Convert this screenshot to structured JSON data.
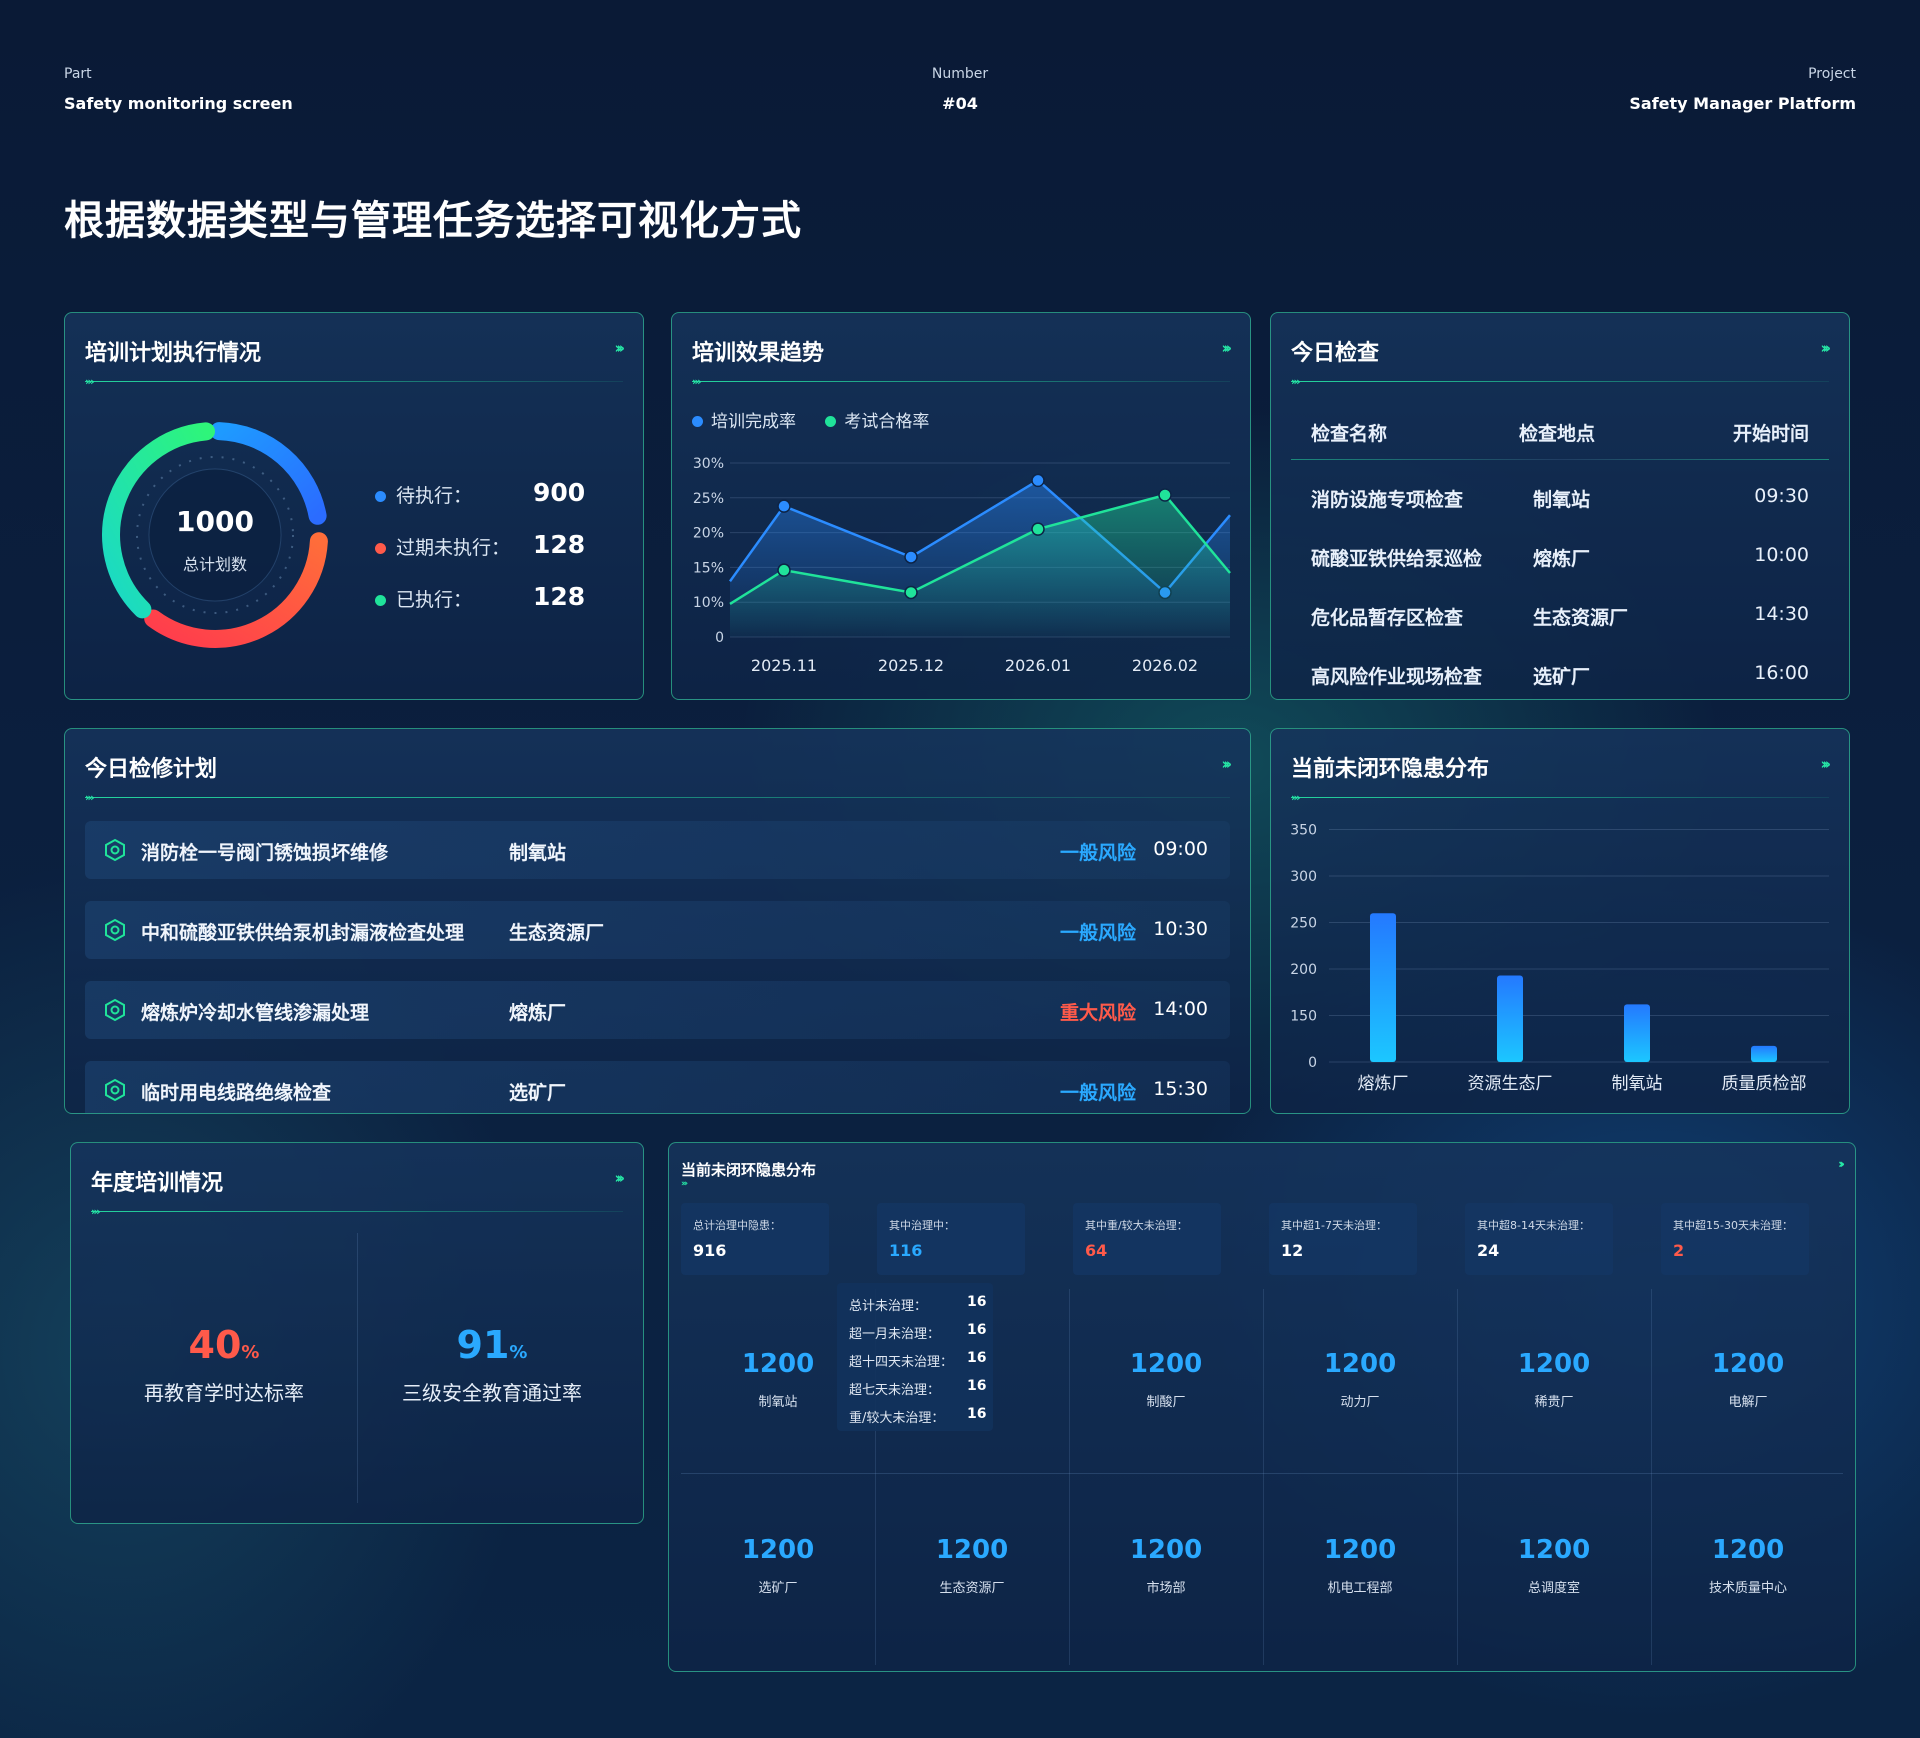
{
  "header": {
    "part_label": "Part",
    "part_value": "Safety monitoring screen",
    "number_label": "Number",
    "number_value": "#04",
    "project_label": "Project",
    "project_value": "Safety Manager Platform",
    "title": "根据数据类型与管理任务选择可视化方式"
  },
  "training_plan": {
    "title": "培训计划执行情况",
    "total": "1000",
    "total_label": "总计划数",
    "legend": [
      {
        "label": "待执行：",
        "value": "900",
        "color": "#2b8cff"
      },
      {
        "label": "过期未执行：",
        "value": "128",
        "color": "#ff5a4a"
      },
      {
        "label": "已执行：",
        "value": "128",
        "color": "#20e39a"
      }
    ]
  },
  "training_effect": {
    "title": "培训效果趋势",
    "chart_data": {
      "type": "area",
      "x": [
        "2025.11",
        "2025.12",
        "2026.01",
        "2026.02"
      ],
      "y_ticks": [
        "0",
        "10%",
        "15%",
        "20%",
        "25%",
        "30%"
      ],
      "series": [
        {
          "name": "培训完成率",
          "color": "#2b8cff",
          "values": [
            23.8,
            16.5,
            27.5,
            11.4
          ]
        },
        {
          "name": "考试合格率",
          "color": "#20e39a",
          "values": [
            14.6,
            11.4,
            20.5,
            25.4
          ]
        }
      ],
      "left_edge": {
        "培训完成率": 13,
        "考试合格率": 9.5
      },
      "right_edge": {
        "培训完成率": 22.5,
        "考试合格率": 14.2
      }
    }
  },
  "today_check": {
    "title": "今日检查",
    "headers": [
      "检查名称",
      "检查地点",
      "开始时间"
    ],
    "rows": [
      [
        "消防设施专项检查",
        "制氧站",
        "09:30"
      ],
      [
        "硫酸亚铁供给泵巡检",
        "熔炼厂",
        "10:00"
      ],
      [
        "危化品暂存区检查",
        "生态资源厂",
        "14:30"
      ],
      [
        "高风险作业现场检查",
        "选矿厂",
        "16:00"
      ]
    ]
  },
  "maintenance": {
    "title": "今日检修计划",
    "rows": [
      {
        "name": "消防栓一号阀门锈蚀损坏维修",
        "loc": "制氧站",
        "risk": "一般风险",
        "risk_color": "#2aa9ff",
        "time": "09:00"
      },
      {
        "name": "中和硫酸亚铁供给泵机封漏液检查处理",
        "loc": "生态资源厂",
        "risk": "一般风险",
        "risk_color": "#2aa9ff",
        "time": "10:30"
      },
      {
        "name": "熔炼炉冷却水管线渗漏处理",
        "loc": "熔炼厂",
        "risk": "重大风险",
        "risk_color": "#ff5a4a",
        "time": "14:00"
      },
      {
        "name": "临时用电线路绝缘检查",
        "loc": "选矿厂",
        "risk": "一般风险",
        "risk_color": "#2aa9ff",
        "time": "15:30"
      }
    ]
  },
  "hazard_bar": {
    "title": "当前未闭环隐患分布",
    "chart_data": {
      "type": "bar",
      "categories": [
        "熔炼厂",
        "资源生态厂",
        "制氧站",
        "质量质检部"
      ],
      "values": [
        260,
        193,
        162,
        52
      ],
      "ylim": [
        0,
        350
      ],
      "y_ticks": [
        "0",
        "150",
        "200",
        "250",
        "300",
        "350"
      ]
    }
  },
  "annual_training": {
    "title": "年度培训情况",
    "items": [
      {
        "value": "40",
        "unit": "%",
        "label": "再教育学时达标率",
        "color": "#ff5a4a"
      },
      {
        "value": "91",
        "unit": "%",
        "label": "三级安全教育通过率",
        "color": "#2aa9ff"
      }
    ]
  },
  "hazard_summary": {
    "title": "当前未闭环隐患分布",
    "cards": [
      {
        "label": "总计治理中隐患：",
        "value": "916",
        "color": "#ffffff"
      },
      {
        "label": "其中治理中：",
        "value": "116",
        "color": "#2aa9ff"
      },
      {
        "label": "其中重/较大未治理：",
        "value": "64",
        "color": "#ff5a4a"
      },
      {
        "label": "其中超1-7天未治理：",
        "value": "12",
        "color": "#ffffff"
      },
      {
        "label": "其中超8-14天未治理：",
        "value": "24",
        "color": "#ffffff"
      },
      {
        "label": "其中超15-30天未治理：",
        "value": "2",
        "color": "#ff5a4a"
      }
    ],
    "row1": [
      {
        "value": "1200",
        "label": "制氧站"
      },
      {
        "value": "",
        "label": ""
      },
      {
        "value": "1200",
        "label": "制酸厂"
      },
      {
        "value": "1200",
        "label": "动力厂"
      },
      {
        "value": "1200",
        "label": "稀贵厂"
      },
      {
        "value": "1200",
        "label": "电解厂"
      }
    ],
    "row2": [
      {
        "value": "1200",
        "label": "选矿厂"
      },
      {
        "value": "1200",
        "label": "生态资源厂"
      },
      {
        "value": "1200",
        "label": "市场部"
      },
      {
        "value": "1200",
        "label": "机电工程部"
      },
      {
        "value": "1200",
        "label": "总调度室"
      },
      {
        "value": "1200",
        "label": "技术质量中心"
      }
    ],
    "popup": [
      {
        "label": "总计未治理：",
        "value": "16"
      },
      {
        "label": "超一月未治理：",
        "value": "16"
      },
      {
        "label": "超十四天未治理：",
        "value": "16"
      },
      {
        "label": "超七天未治理：",
        "value": "16"
      },
      {
        "label": "重/较大未治理：",
        "value": "16"
      }
    ]
  }
}
